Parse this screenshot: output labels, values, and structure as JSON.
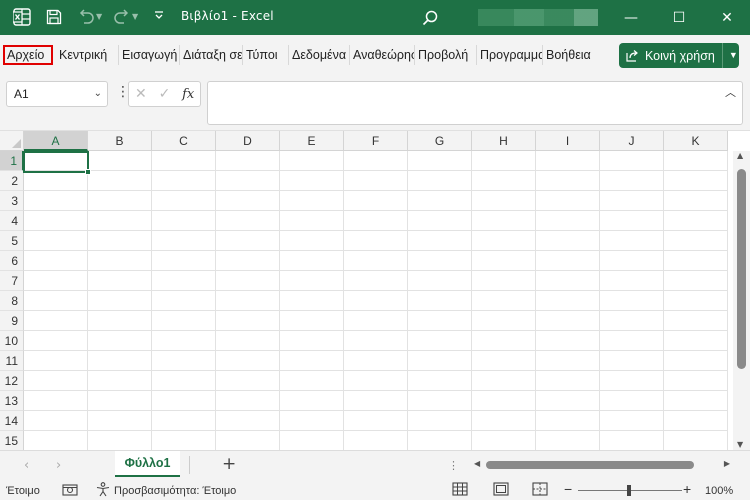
{
  "window": {
    "title": "Βιβλίο1  -  Excel",
    "accent_color": "#1e7145",
    "icons": [
      "excel-icon",
      "save-icon",
      "undo-icon",
      "redo-icon",
      "customize-qat-icon",
      "search-icon",
      "minimize-icon",
      "maximize-icon",
      "close-icon"
    ],
    "minimize_glyph": "—",
    "maximize_glyph": "☐",
    "close_glyph": "✕"
  },
  "ribbon": {
    "tabs": [
      "Αρχείο",
      "Κεντρική",
      "Εισαγωγή",
      "Διάταξη σελίδας",
      "Τύποι",
      "Δεδομένα",
      "Αναθεώρηση",
      "Προβολή",
      "Προγραμματιστής",
      "Βοήθεια"
    ],
    "share_label": "Κοινή χρήση"
  },
  "formula_bar": {
    "name_box": "A1",
    "formula": ""
  },
  "grid": {
    "columns": [
      "A",
      "B",
      "C",
      "D",
      "E",
      "F",
      "G",
      "H",
      "I",
      "J",
      "K"
    ],
    "rows": [
      "1",
      "2",
      "3",
      "4",
      "5",
      "6",
      "7",
      "8",
      "9",
      "10",
      "11",
      "12",
      "13",
      "14",
      "15"
    ],
    "active_cell": "A1"
  },
  "sheets": {
    "tabs": [
      "Φύλλο1"
    ],
    "active": "Φύλλο1"
  },
  "status_bar": {
    "ready": "Έτοιμο",
    "accessibility": "Προσβασιμότητα: Έτοιμο",
    "zoom": "100%"
  }
}
